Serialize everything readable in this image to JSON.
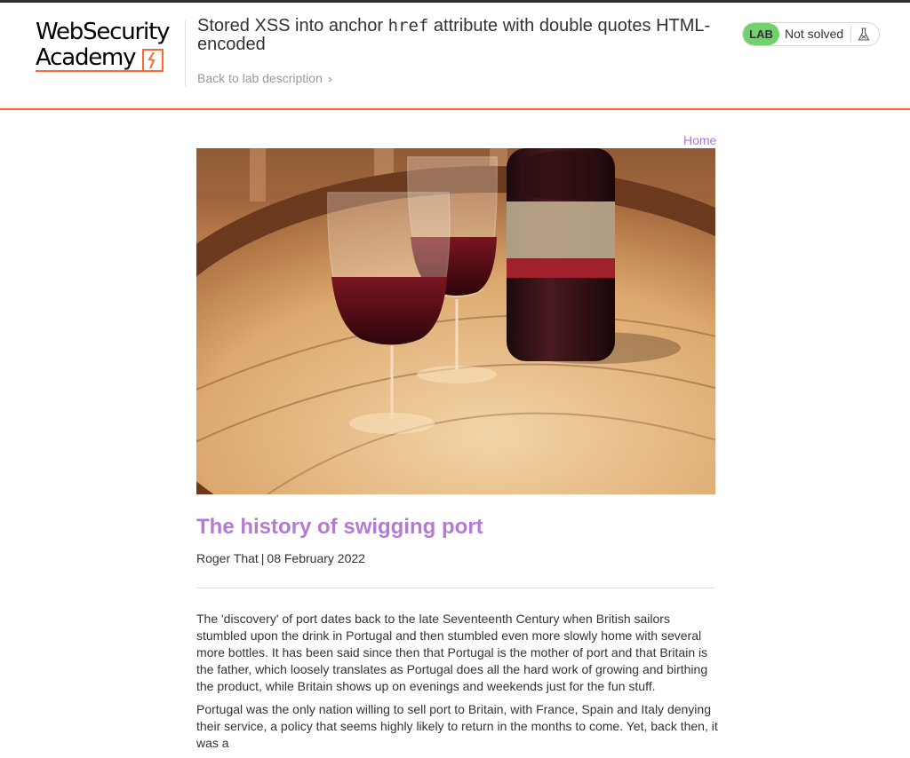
{
  "header": {
    "logo_line1": "WebSecurity",
    "logo_line2": "Academy",
    "lab_title_prefix": "Stored XSS into anchor ",
    "lab_title_code": "href",
    "lab_title_suffix": " attribute with double quotes HTML-encoded",
    "back_link": "Back to lab description",
    "status_badge": "LAB",
    "status_text": "Not solved"
  },
  "nav": {
    "home": "Home"
  },
  "post": {
    "title": "The history of swigging port",
    "author": "Roger That",
    "date": "08 February 2022",
    "paragraphs": [
      "The 'discovery' of port dates back to the late Seventeenth Century when British sailors stumbled upon the drink in Portugal and then stumbled even more slowly home with several more bottles. It has been said since then that Portugal is the mother of port and that Britain is the father, which loosely translates as Portugal does all the hard work of growing and birthing the product, while Britain shows up on evenings and weekends just for the fun stuff.",
      "Portugal was the only nation willing to sell port to Britain, with France, Spain and Italy denying their service, a policy that seems highly likely to return in the months to come. Yet, back then, it was a"
    ]
  },
  "colors": {
    "accent_orange": "#ff6633",
    "lab_green": "#70d16d",
    "link_purple": "#a57bd1"
  }
}
